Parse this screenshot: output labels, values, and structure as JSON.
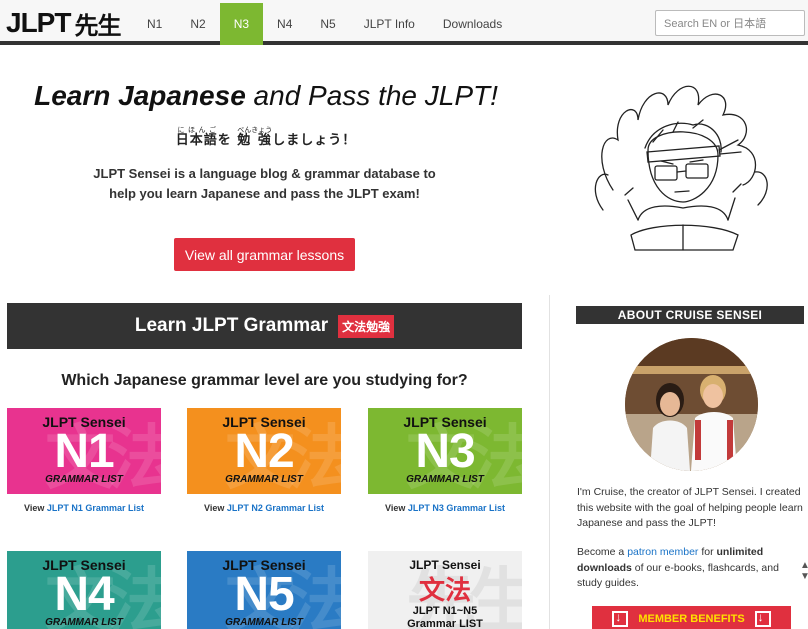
{
  "logo": {
    "latin": "JLPT",
    "kanji": "先生"
  },
  "nav": {
    "items": [
      {
        "label": "N1",
        "active": false
      },
      {
        "label": "N2",
        "active": false
      },
      {
        "label": "N3",
        "active": true
      },
      {
        "label": "N4",
        "active": false
      },
      {
        "label": "N5",
        "active": false
      },
      {
        "label": "JLPT Info",
        "active": false
      },
      {
        "label": "Downloads",
        "active": false
      }
    ],
    "search_placeholder": "Search EN or 日本語"
  },
  "hero": {
    "title_bold": "Learn Japanese",
    "title_rest": "and Pass the JLPT!",
    "sub_parts": [
      {
        "text": "日本語",
        "ruby": "にほんご"
      },
      {
        "text": "を ",
        "ruby": ""
      },
      {
        "text": "勉",
        "ruby": "べん"
      },
      {
        "text": " 強",
        "ruby": "きょう"
      },
      {
        "text": "しましょう！",
        "ruby": ""
      }
    ],
    "description": "JLPT Sensei is a language blog & grammar database to help you learn Japanese and pass the JLPT exam!",
    "button_label": "View all grammar lessons"
  },
  "grammar": {
    "banner_title": "Learn JLPT Grammar",
    "banner_tag": "文法勉強",
    "question": "Which Japanese grammar level are you studying for?",
    "bg_kanji": "文法",
    "cards": [
      {
        "title": "JLPT Sensei",
        "level": "N1",
        "list": "GRAMMAR LIST",
        "link_prefix": "View",
        "link_text": "JLPT N1 Grammar List",
        "color": "#e8338f"
      },
      {
        "title": "JLPT Sensei",
        "level": "N2",
        "list": "GRAMMAR LIST",
        "link_prefix": "View",
        "link_text": "JLPT N2 Grammar List",
        "color": "#f4901e"
      },
      {
        "title": "JLPT Sensei",
        "level": "N3",
        "list": "GRAMMAR LIST",
        "link_prefix": "View",
        "link_text": "JLPT N3 Grammar List",
        "color": "#7db831"
      },
      {
        "title": "JLPT Sensei",
        "level": "N4",
        "list": "GRAMMAR LIST",
        "color": "#2c9e8e"
      },
      {
        "title": "JLPT Sensei",
        "level": "N5",
        "list": "GRAMMAR LIST",
        "color": "#2a7bc4"
      }
    ],
    "all_card": {
      "title": "JLPT Sensei",
      "kanji": "文法",
      "sub": "JLPT N1~N5",
      "sub2": "Grammar LIST",
      "bg_kanji": "先生"
    }
  },
  "about": {
    "heading": "ABOUT CRUISE SENSEI",
    "text1": "I'm Cruise, the creator of JLPT Sensei. I created this website with the goal of helping people learn Japanese and pass the JLPT!",
    "text2_a": "Become a ",
    "text2_link": "patron member",
    "text2_b": " for ",
    "text2_bold": "unlimited downloads",
    "text2_c": " of our e-books, flashcards, and study guides.",
    "member_button": "MEMBER BENEFITS"
  }
}
